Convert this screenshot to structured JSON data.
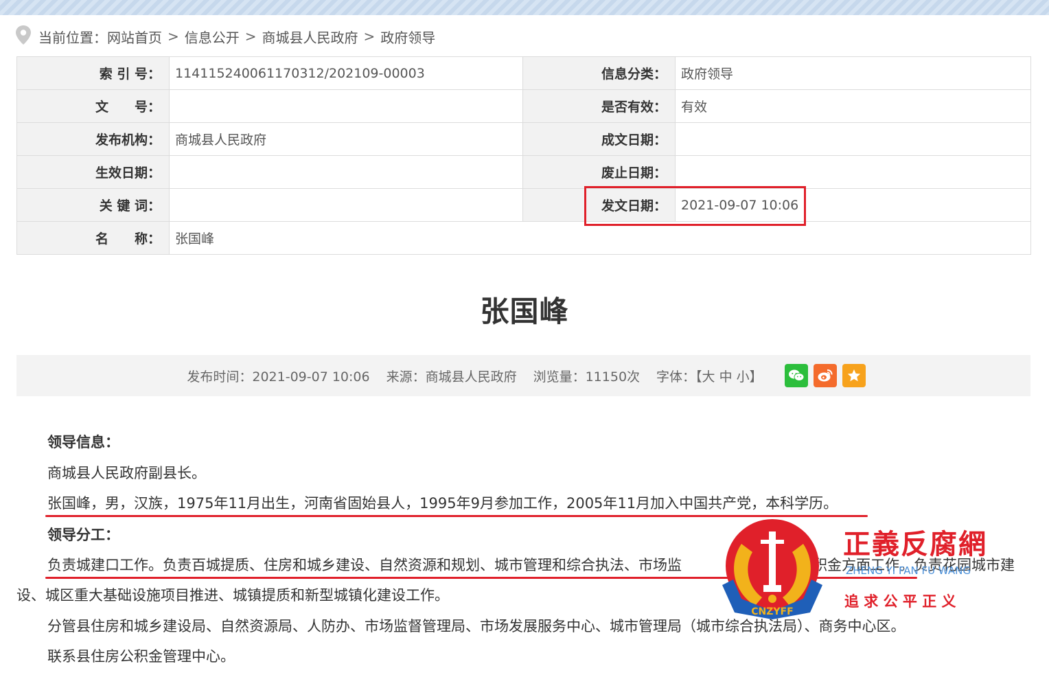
{
  "breadcrumb": {
    "prefix": "当前位置：",
    "items": [
      "网站首页",
      "信息公开",
      "商城县人民政府",
      "政府领导"
    ],
    "separator": ">"
  },
  "meta": {
    "index_label": "索 引 号：",
    "index_value": "114115240061170312/202109-00003",
    "category_label": "信息分类：",
    "category_value": "政府领导",
    "docno_label": "文　　号：",
    "docno_value": "",
    "valid_label": "是否有效：",
    "valid_value": "有效",
    "publisher_label": "发布机构：",
    "publisher_value": "商城县人民政府",
    "written_label": "成文日期：",
    "written_value": "",
    "effective_label": "生效日期：",
    "effective_value": "",
    "abolish_label": "废止日期：",
    "abolish_value": "",
    "keywords_label": "关 键 词：",
    "keywords_value": "",
    "issue_label": "发文日期：",
    "issue_value": "2021-09-07 10:06",
    "name_label": "名　　称：",
    "name_value": "张国峰"
  },
  "article": {
    "title": "张国峰",
    "publish_time": "发布时间：2021-09-07 10:06",
    "source": "来源：商城县人民政府",
    "views": "浏览量：11150次",
    "font_size": "字体：【大 中 小】",
    "share_icons": [
      "wechat-icon",
      "weibo-icon",
      "favorite-icon"
    ],
    "share_colors": {
      "wechat": "#2cbe3c",
      "weibo": "#f46b2c",
      "favorite": "#f7a21c"
    }
  },
  "body": {
    "leader_info_heading": "领导信息：",
    "position": "商城县人民政府副县长。",
    "bio": "张国峰，男，汉族，1975年11月出生，河南省固始县人，1995年9月参加工作，2005年11月加入中国共产党，本科学历。",
    "division_heading": "领导分工：",
    "duties_line1": "负责城建口工作。负责百城提质、住房和城乡建设、自然资源和规划、城市管理和综合执法、市场监",
    "duties_line1_tail_a": "积金方面工作。负责花园城市建",
    "duties_line2": "设、城区重大基础设施项目推进、城镇提质和新型城镇化建设工作。",
    "manages": "分管县住房和城乡建设局、自然资源局、人防办、市场监督管理局、市场发展服务中心、城市管理局（城市综合执法局）、商务中心区。",
    "contacts": "联系县住房公积金管理中心。"
  },
  "watermark": {
    "title": "正義反腐網",
    "pinyin": "ZHENG YI FAN FU WANG",
    "slogan": "追 求 公 平 正 义",
    "badge_text": "CNZYFF",
    "colors": {
      "red": "#e0202a",
      "gold": "#f2b21b",
      "blue": "#1f5fb8"
    }
  }
}
